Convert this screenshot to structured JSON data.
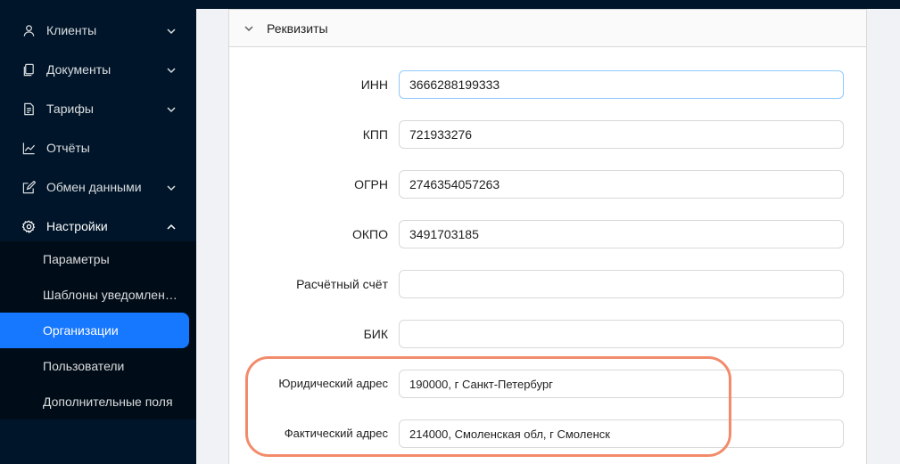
{
  "sidebar": {
    "items": [
      {
        "label": "Клиенты",
        "icon": "user-icon"
      },
      {
        "label": "Документы",
        "icon": "documents-icon"
      },
      {
        "label": "Тарифы",
        "icon": "tariff-icon"
      },
      {
        "label": "Отчёты",
        "icon": "chart-icon"
      },
      {
        "label": "Обмен данными",
        "icon": "exchange-icon"
      },
      {
        "label": "Настройки",
        "icon": "settings-icon"
      }
    ],
    "submenu": [
      {
        "label": "Параметры"
      },
      {
        "label": "Шаблоны уведомлений"
      },
      {
        "label": "Организации"
      },
      {
        "label": "Пользователи"
      },
      {
        "label": "Дополнительные поля"
      }
    ],
    "active_submenu": "Организации"
  },
  "panel": {
    "title": "Реквизиты",
    "fields": [
      {
        "label": "ИНН",
        "value": "3666288199333"
      },
      {
        "label": "КПП",
        "value": "721933276"
      },
      {
        "label": "ОГРН",
        "value": "2746354057263"
      },
      {
        "label": "ОКПО",
        "value": "3491703185"
      },
      {
        "label": "Расчётный счёт",
        "value": ""
      },
      {
        "label": "БИК",
        "value": ""
      },
      {
        "label": "Юридический адрес",
        "value": "190000, г Санкт-Петербург"
      },
      {
        "label": "Фактический адрес",
        "value": "214000, Смоленская обл, г Смоленск"
      }
    ]
  },
  "colors": {
    "sidebar_bg": "#001529",
    "submenu_bg": "#000c17",
    "active": "#1677ff",
    "highlight": "#f28b6b"
  }
}
